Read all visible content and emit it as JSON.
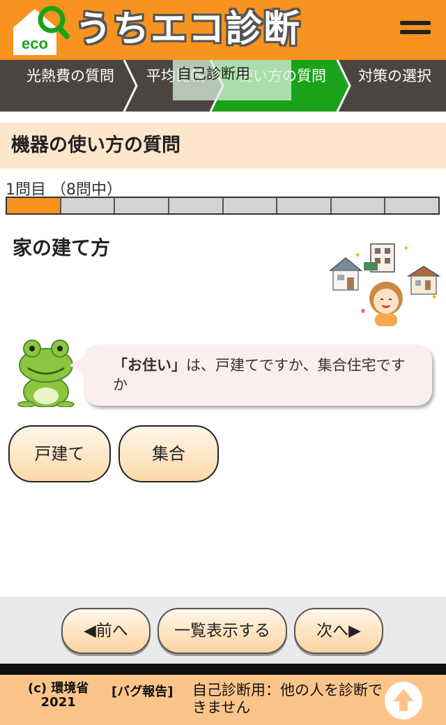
{
  "header": {
    "logo_text": "eco",
    "title": "うちエコ診断",
    "menu_icon": "hamburger-menu-icon"
  },
  "steps": [
    {
      "label": "光熱費の質問",
      "active": false
    },
    {
      "label": "平均比較",
      "active": false
    },
    {
      "label": "使い方の質問",
      "active": true
    },
    {
      "label": "対策の選択",
      "active": false
    }
  ],
  "overlay_label": "自己診断用",
  "section": {
    "title": "機器の使い方の質問"
  },
  "progress": {
    "text": "1問目 （8問中）",
    "current": 1,
    "total": 8
  },
  "question": {
    "title": "家の建て方",
    "bubble_emphasis": "「お住い」",
    "bubble_text": "は、戸建てですか、集合住宅ですか"
  },
  "choices": [
    "戸建て",
    "集合"
  ],
  "nav": {
    "prev": "◀前へ",
    "list": "一覧表示する",
    "next": "次へ▶"
  },
  "footer": {
    "copyright_line1": "(c) 環境省",
    "copyright_line2": "2021",
    "bug_report": "[バグ報告]",
    "note": "自己診断用：他の人を診断できません",
    "top_icon": "arrow-up-icon"
  },
  "colors": {
    "brand_orange": "#f7931e",
    "step_bg": "#4a4540",
    "step_active": "#1aa31a",
    "section_bg": "#fde6cc",
    "footer_bg": "#fbc58a"
  }
}
